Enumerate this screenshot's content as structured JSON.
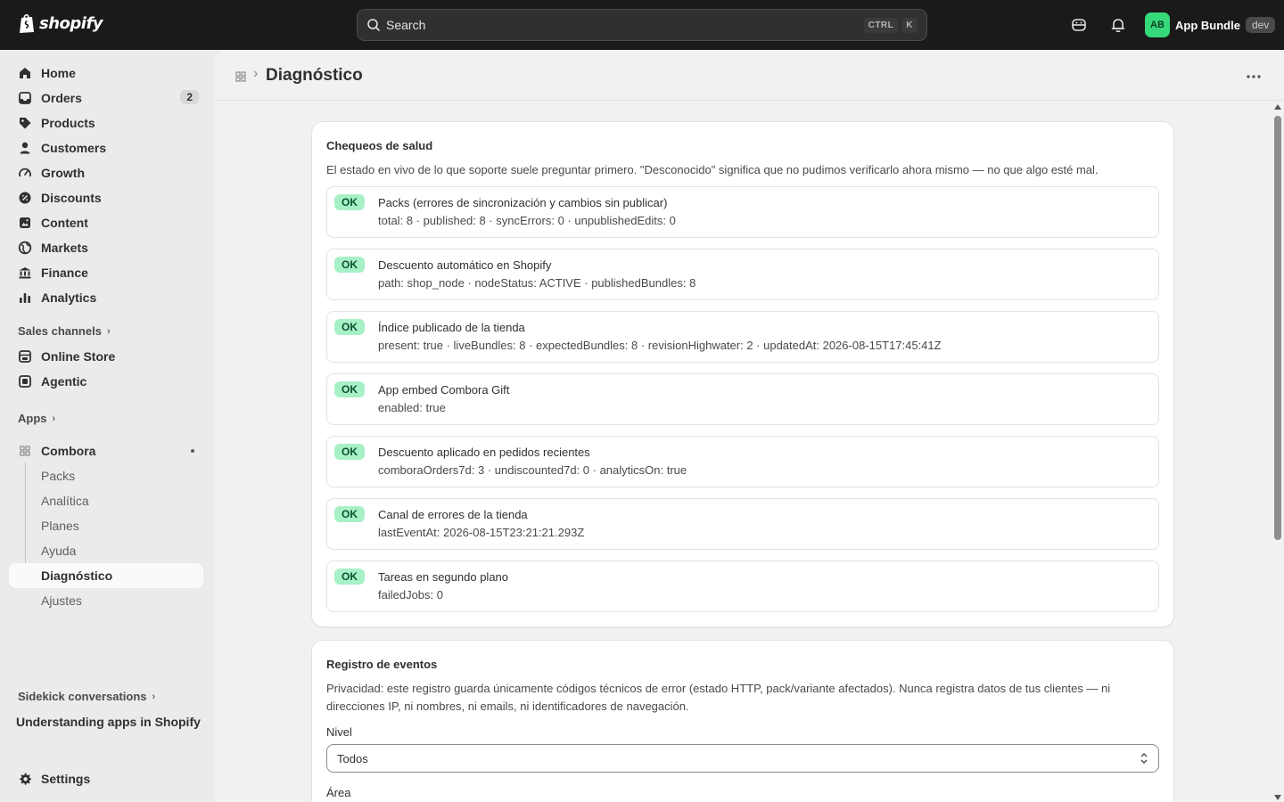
{
  "topbar": {
    "logo_text": "shopify",
    "search": {
      "placeholder": "Search",
      "shortcut_mod": "CTRL",
      "shortcut_key": "K"
    },
    "store": {
      "initials": "AB",
      "name": "App Bundle",
      "badge": "dev"
    }
  },
  "sidebar": {
    "items": [
      {
        "label": "Home",
        "icon": "home-icon"
      },
      {
        "label": "Orders",
        "icon": "orders-icon",
        "count": "2"
      },
      {
        "label": "Products",
        "icon": "tag-icon"
      },
      {
        "label": "Customers",
        "icon": "person-icon"
      },
      {
        "label": "Growth",
        "icon": "gauge-icon"
      },
      {
        "label": "Discounts",
        "icon": "discount-icon"
      },
      {
        "label": "Content",
        "icon": "content-icon"
      },
      {
        "label": "Markets",
        "icon": "globe-icon"
      },
      {
        "label": "Finance",
        "icon": "bank-icon"
      },
      {
        "label": "Analytics",
        "icon": "bar-chart-icon"
      }
    ],
    "sales_channels_label": "Sales channels",
    "channels": [
      {
        "label": "Online Store",
        "icon": "store-icon"
      },
      {
        "label": "Agentic",
        "icon": "agentic-icon"
      }
    ],
    "apps_label": "Apps",
    "app": {
      "name": "Combora",
      "subitems": [
        "Packs",
        "Analítica",
        "Planes",
        "Ayuda",
        "Diagnóstico",
        "Ajustes"
      ],
      "active": "Diagnóstico"
    },
    "sidekick_label": "Sidekick conversations",
    "sidekick_item": "Understanding apps in Shopify",
    "settings_label": "Settings"
  },
  "page": {
    "title": "Diagnóstico"
  },
  "health": {
    "title": "Chequeos de salud",
    "description": "El estado en vivo de lo que soporte suele preguntar primero. \"Desconocido\" significa que no pudimos verificarlo ahora mismo — no que algo esté mal.",
    "checks": [
      {
        "status": "OK",
        "title": "Packs (errores de sincronización y cambios sin publicar)",
        "detail": "total: 8 · published: 8 · syncErrors: 0 · unpublishedEdits: 0"
      },
      {
        "status": "OK",
        "title": "Descuento automático en Shopify",
        "detail": "path: shop_node · nodeStatus: ACTIVE · publishedBundles: 8"
      },
      {
        "status": "OK",
        "title": "Índice publicado de la tienda",
        "detail": "present: true · liveBundles: 8 · expectedBundles: 8 · revisionHighwater: 2 · updatedAt: 2026-08-15T17:45:41Z"
      },
      {
        "status": "OK",
        "title": "App embed Combora Gift",
        "detail": "enabled: true"
      },
      {
        "status": "OK",
        "title": "Descuento aplicado en pedidos recientes",
        "detail": "comboraOrders7d: 3 · undiscounted7d: 0 · analyticsOn: true"
      },
      {
        "status": "OK",
        "title": "Canal de errores de la tienda",
        "detail": "lastEventAt: 2026-08-15T23:21:21.293Z"
      },
      {
        "status": "OK",
        "title": "Tareas en segundo plano",
        "detail": "failedJobs: 0"
      }
    ]
  },
  "events": {
    "title": "Registro de eventos",
    "description": "Privacidad: este registro guarda únicamente códigos técnicos de error (estado HTTP, pack/variante afectados). Nunca registra datos de tus clientes — ni direcciones IP, ni nombres, ni emails, ni identificadores de navegación.",
    "level_label": "Nivel",
    "level_value": "Todos",
    "area_label": "Área"
  },
  "colors": {
    "topbar_bg": "#1a1a1a",
    "ok_badge_bg": "#a8f0c6",
    "ok_badge_text": "#0c5132",
    "avatar_bg": "#36d97a"
  }
}
